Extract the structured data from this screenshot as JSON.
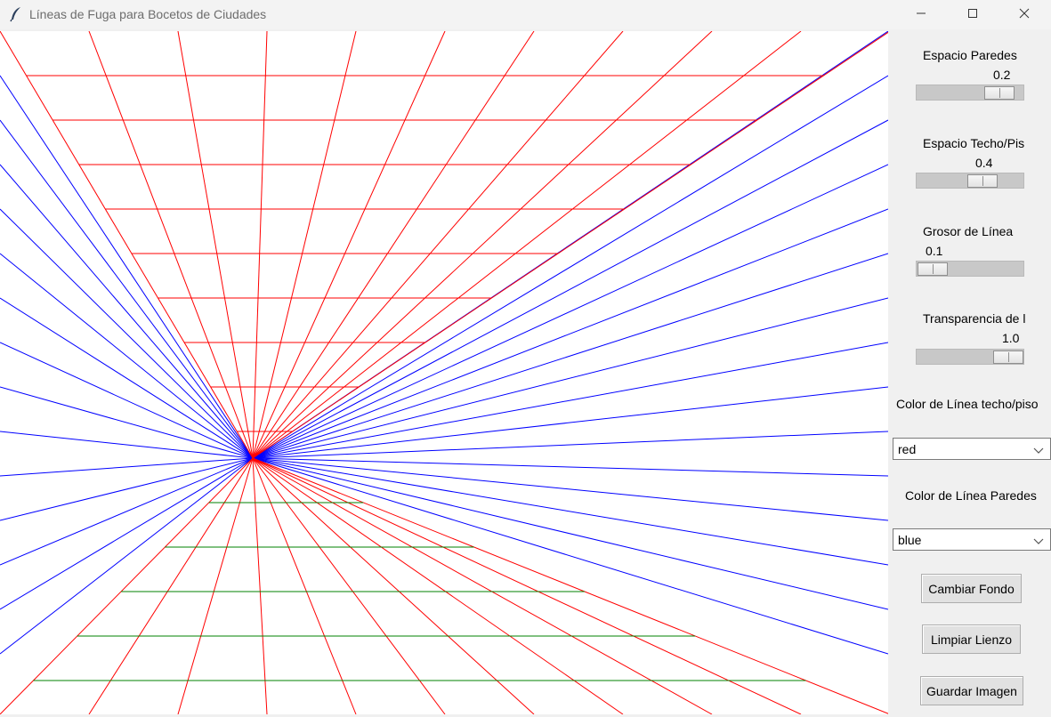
{
  "window": {
    "title": "Líneas de Fuga para Bocetos de Ciudades"
  },
  "icons": {
    "app": "feather-icon",
    "minimize": "minimize-icon",
    "maximize": "maximize-icon",
    "close": "close-icon",
    "dropdown": "chevron-down-icon"
  },
  "controls": {
    "espacio_paredes": {
      "label": "Espacio Paredes",
      "value": "0.2"
    },
    "espacio_techo_piso": {
      "label": "Espacio Techo/Pis",
      "value": "0.4"
    },
    "grosor_linea": {
      "label": "Grosor de Línea",
      "value": "0.1"
    },
    "transparencia": {
      "label": "Transparencia de l",
      "value": "1.0"
    },
    "color_techo_piso": {
      "label": "Color de Línea techo/piso",
      "selected": "red"
    },
    "color_paredes": {
      "label": "Color de Línea Paredes",
      "selected": "blue"
    }
  },
  "buttons": {
    "cambiar_fondo": "Cambiar Fondo",
    "limpiar_lienzo": "Limpiar Lienzo",
    "guardar_imagen": "Guardar Imagen"
  },
  "colors": {
    "ceiling_lines": "#ff0000",
    "wall_lines": "#0000ff",
    "floor_lines": "#008000",
    "canvas_background": "#ffffff"
  }
}
